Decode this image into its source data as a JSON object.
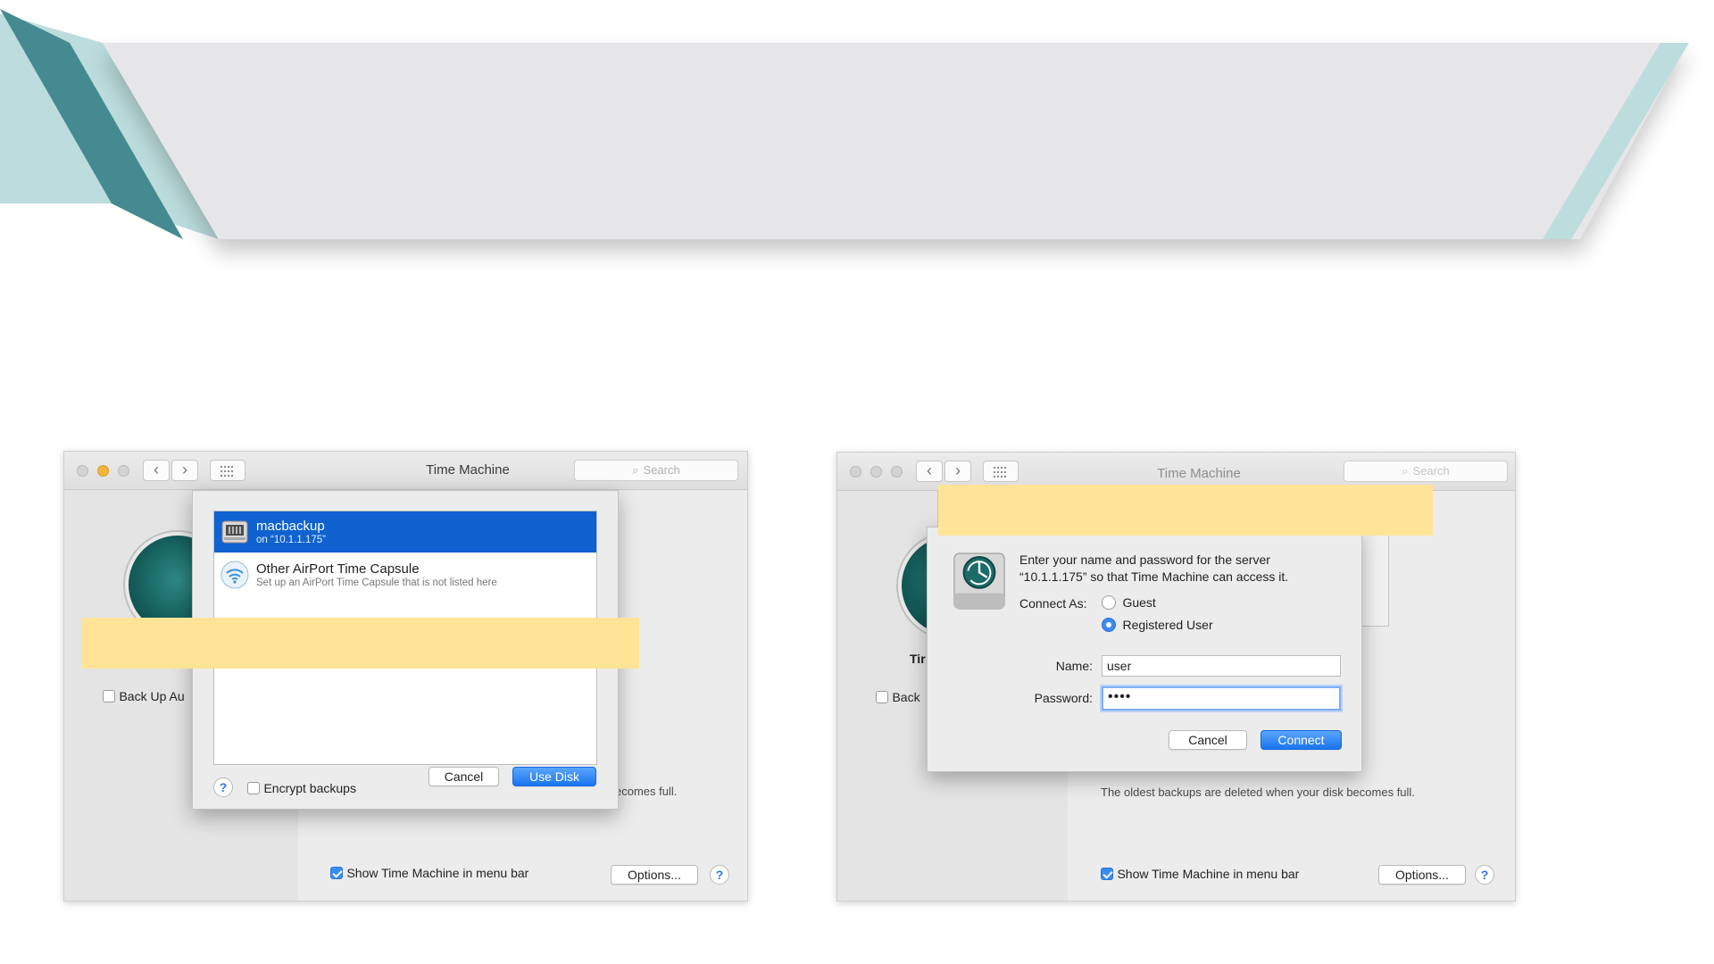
{
  "colors": {
    "banner_fill": "#e6e6e8",
    "banner_dark": "#458a90",
    "banner_light": "#bcdcdd",
    "highlight": "#ffe397",
    "selection_blue": "#0f62d0",
    "primary_button": "#1a74f0"
  },
  "window_left": {
    "title": "Time Machine",
    "search_placeholder": "Search",
    "icons": [
      "back-chevron-icon",
      "forward-chevron-icon",
      "grid-icon",
      "search-icon",
      "time-machine-icon"
    ],
    "back_up_label": "Back Up Au",
    "partial_status": "ecomes full.",
    "show_menubar_label": "Show Time Machine in menu bar",
    "show_menubar_checked": true,
    "options_label": "Options...",
    "help_label": "?",
    "dialog": {
      "disks": [
        {
          "name": "macbackup",
          "detail": "on “10.1.1.175”",
          "icon": "network-drive-icon",
          "selected": true
        },
        {
          "name": "Other AirPort Time Capsule",
          "detail": "Set up an AirPort Time Capsule that is not listed here",
          "icon": "wifi-icon",
          "selected": false
        }
      ],
      "help_label": "?",
      "encrypt_label": "Encrypt backups",
      "encrypt_checked": false,
      "cancel_label": "Cancel",
      "use_disk_label": "Use Disk"
    }
  },
  "window_right": {
    "title": "Time Machine",
    "search_placeholder": "Search",
    "partial_title": "Tir",
    "back_up_label": "Back",
    "oldest_text": "The oldest backups are deleted when your disk becomes full.",
    "show_menubar_label": "Show Time Machine in menu bar",
    "show_menubar_checked": true,
    "options_label": "Options...",
    "help_label": "?",
    "dialog": {
      "message_line1": "Enter your name and password for the server",
      "message_line2": "“10.1.1.175” so that Time Machine can access it.",
      "connect_as_label": "Connect As:",
      "guest_label": "Guest",
      "registered_label": "Registered User",
      "selected_option": "Registered User",
      "name_label": "Name:",
      "name_value": "user",
      "password_label": "Password:",
      "password_value": "••••",
      "cancel_label": "Cancel",
      "connect_label": "Connect"
    }
  }
}
